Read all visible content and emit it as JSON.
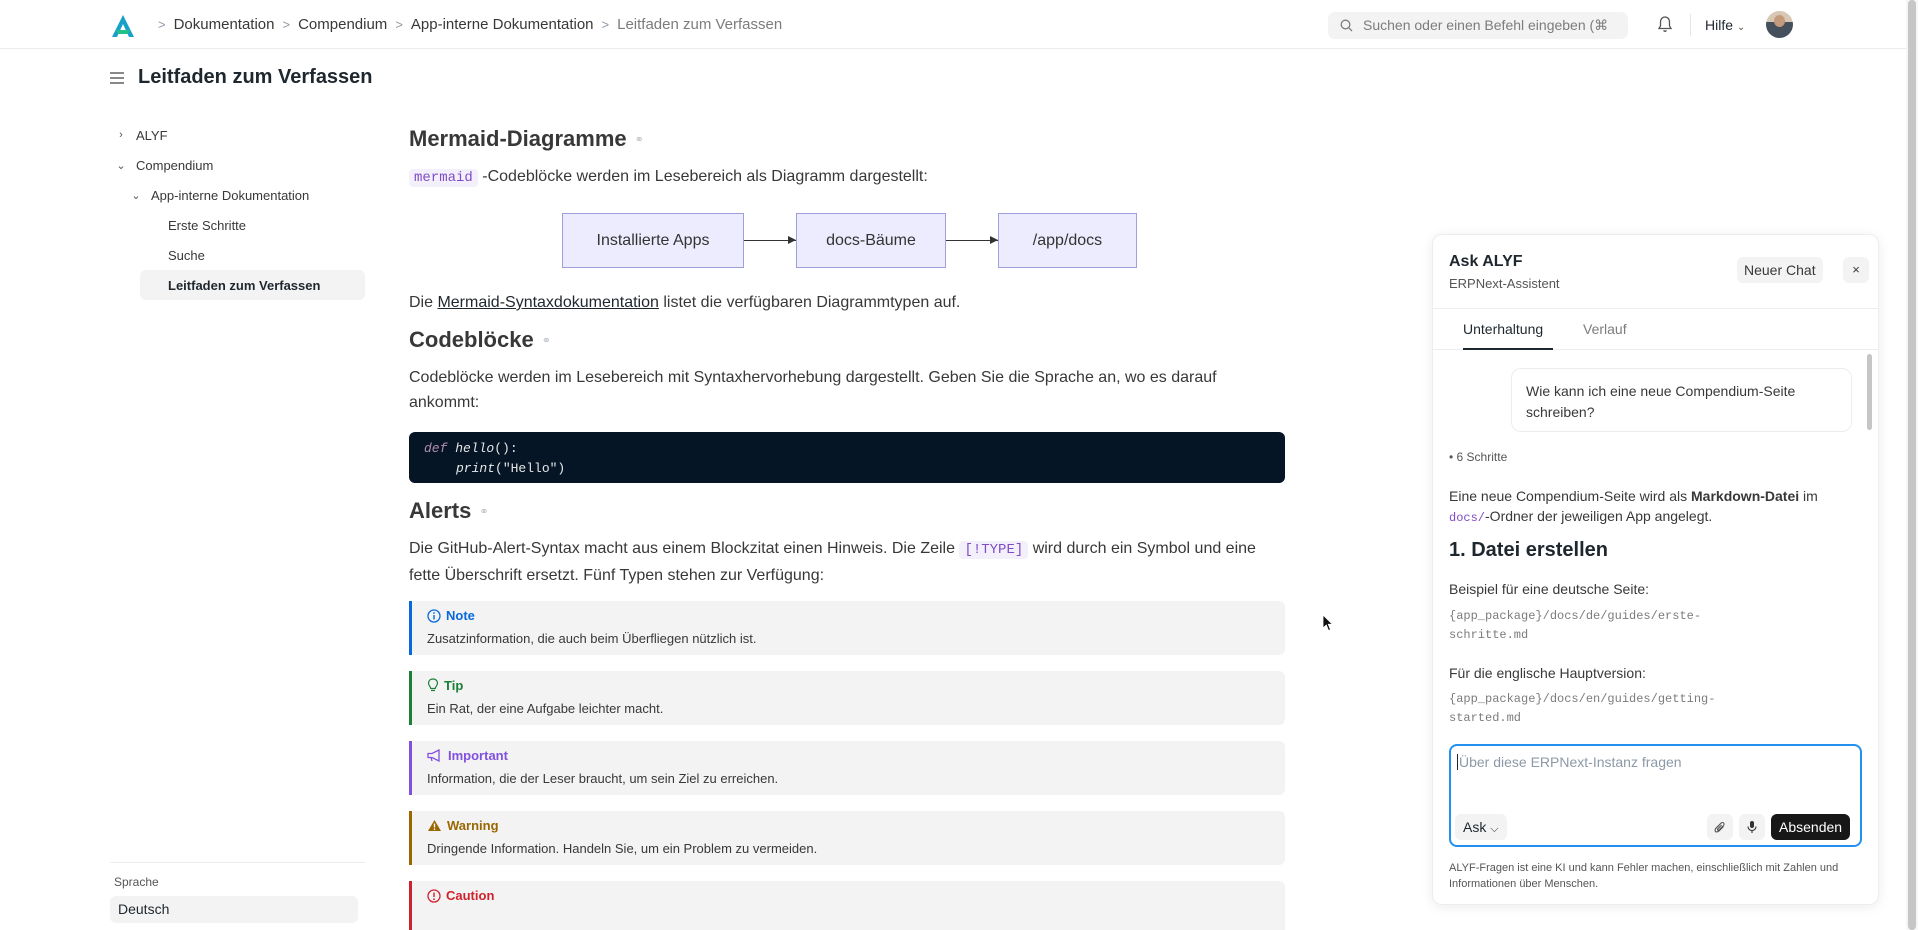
{
  "topbar": {
    "breadcrumb": [
      "Dokumentation",
      "Compendium",
      "App-interne Dokumentation",
      "Leitfaden zum Verfassen"
    ],
    "search_placeholder": "Suchen oder einen Befehl eingeben (⌘",
    "help_label": "Hilfe"
  },
  "page": {
    "title": "Leitfaden zum Verfassen"
  },
  "sidebar": {
    "tree": [
      {
        "label": "ALYF",
        "level": 0,
        "expanded": false
      },
      {
        "label": "Compendium",
        "level": 0,
        "expanded": true
      },
      {
        "label": "App-interne Dokumentation",
        "level": 1,
        "expanded": true
      },
      {
        "label": "Erste Schritte",
        "level": 2
      },
      {
        "label": "Suche",
        "level": 2
      },
      {
        "label": "Leitfaden zum Verfassen",
        "level": 2,
        "active": true
      }
    ],
    "language_label": "Sprache",
    "language_value": "Deutsch"
  },
  "content": {
    "mermaid": {
      "heading": "Mermaid-Diagramme",
      "code_inline": "mermaid",
      "intro": "-Codeblöcke werden im Lesebereich als Diagramm dargestellt:",
      "nodes": [
        "Installierte Apps",
        "docs-Bäume",
        "/app/docs"
      ],
      "text_before": "Die ",
      "link": "Mermaid-Syntaxdokumentation",
      "text_after": " listet die verfügbaren Diagrammtypen auf."
    },
    "codeblocks": {
      "heading": "Codeblöcke",
      "text": "Codeblöcke werden im Lesebereich mit Syntaxhervorhebung dargestellt. Geben Sie die Sprache an, wo es darauf ankommt:",
      "line1_kw": "def",
      "line1_fn": "hello",
      "line1_rest": "():",
      "line2_fn": "print",
      "line2_rest": "(\"Hello\")"
    },
    "alerts": {
      "heading": "Alerts",
      "text_before": "Die GitHub-Alert-Syntax macht aus einem Blockzitat einen Hinweis. Die Zeile ",
      "code_inline": "[!TYPE]",
      "text_after": " wird durch ein Symbol und eine fette Überschrift ersetzt. Fünf Typen stehen zur Verfügung:",
      "items": [
        {
          "title": "Note",
          "text": "Zusatzinformation, die auch beim Überfliegen nützlich ist.",
          "color": "#0969da",
          "icon": "info-icon"
        },
        {
          "title": "Tip",
          "text": "Ein Rat, der eine Aufgabe leichter macht.",
          "color": "#1a7f37",
          "icon": "lightbulb-icon"
        },
        {
          "title": "Important",
          "text": "Information, die der Leser braucht, um sein Ziel zu erreichen.",
          "color": "#8250df",
          "icon": "megaphone-icon"
        },
        {
          "title": "Warning",
          "text": "Dringende Information. Handeln Sie, um ein Problem zu vermeiden.",
          "color": "#9a6700",
          "icon": "warning-icon"
        },
        {
          "title": "Caution",
          "text": "",
          "color": "#cf222e",
          "icon": "stop-icon"
        }
      ]
    }
  },
  "assistant": {
    "title": "Ask ALYF",
    "subtitle": "ERPNext-Assistent",
    "new_chat_label": "Neuer Chat",
    "close_label": "×",
    "tabs": [
      "Unterhaltung",
      "Verlauf"
    ],
    "user_message": "Wie kann ich eine neue Compendium-Seite schreiben?",
    "steps_label": "6 Schritte",
    "answer_intro_1": "Eine neue Compendium-Seite wird als ",
    "answer_intro_bold": "Markdown-Datei",
    "answer_intro_2": " im ",
    "answer_intro_code": "docs/",
    "answer_intro_3": "-Ordner der jeweiligen App angelegt.",
    "answer_heading": "1. Datei erstellen",
    "example_de_label": "Beispiel für eine deutsche Seite:",
    "example_de_path_1": "{app_package}/docs/de/guides/erste-",
    "example_de_path_2": "schritte.md",
    "example_en_label": "Für die englische Hauptversion:",
    "example_en_path_1": "{app_package}/docs/en/guides/getting-",
    "example_en_path_2": "started.md",
    "input_placeholder": "Über diese ERPNext-Instanz fragen",
    "mode_label": "Ask",
    "send_label": "Absenden",
    "disclaimer": "ALYF-Fragen ist eine KI und kann Fehler machen, einschließlich mit Zahlen und Informationen über Menschen."
  }
}
